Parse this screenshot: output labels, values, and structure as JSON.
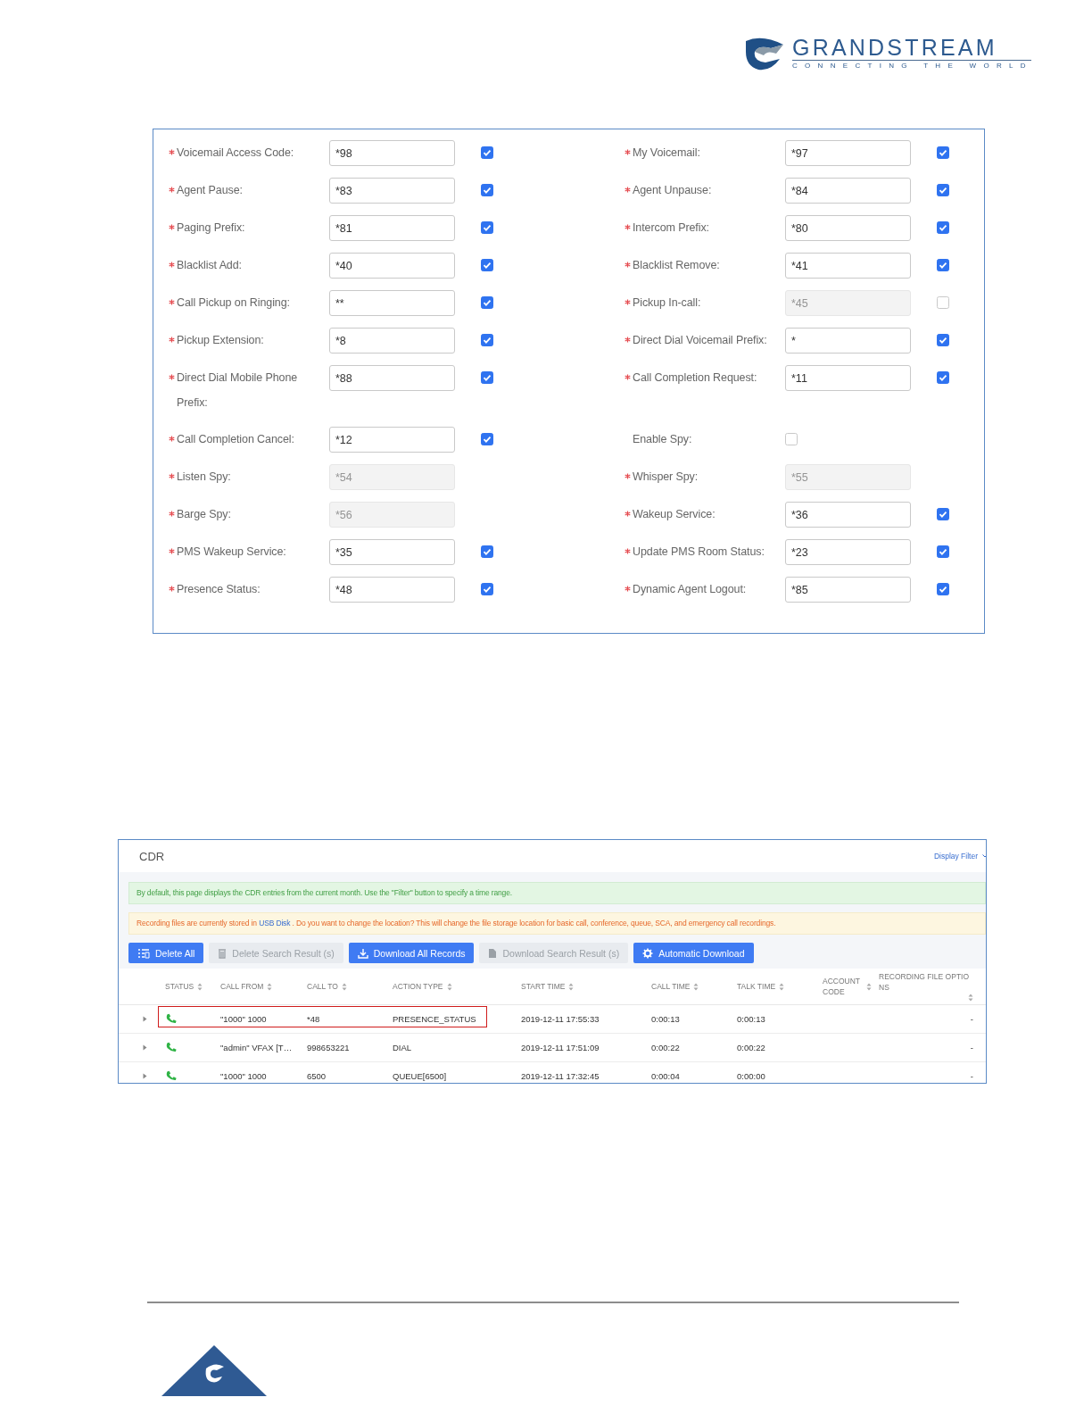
{
  "logo": {
    "name": "GRANDSTREAM",
    "tagline": "CONNECTING THE WORLD"
  },
  "feature_codes": {
    "rows": [
      {
        "left": {
          "kind": "code",
          "label": "Voicemail Access Code:",
          "required": true,
          "value": "*98",
          "disabled": false,
          "checked": true
        },
        "right": {
          "kind": "code",
          "label": "My Voicemail:",
          "required": true,
          "value": "*97",
          "disabled": false,
          "checked": true
        }
      },
      {
        "left": {
          "kind": "code",
          "label": "Agent Pause:",
          "required": true,
          "value": "*83",
          "disabled": false,
          "checked": true
        },
        "right": {
          "kind": "code",
          "label": "Agent Unpause:",
          "required": true,
          "value": "*84",
          "disabled": false,
          "checked": true
        }
      },
      {
        "left": {
          "kind": "code",
          "label": "Paging Prefix:",
          "required": true,
          "value": "*81",
          "disabled": false,
          "checked": true
        },
        "right": {
          "kind": "code",
          "label": "Intercom Prefix:",
          "required": true,
          "value": "*80",
          "disabled": false,
          "checked": true
        }
      },
      {
        "left": {
          "kind": "code",
          "label": "Blacklist Add:",
          "required": true,
          "value": "*40",
          "disabled": false,
          "checked": true
        },
        "right": {
          "kind": "code",
          "label": "Blacklist Remove:",
          "required": true,
          "value": "*41",
          "disabled": false,
          "checked": true
        }
      },
      {
        "left": {
          "kind": "code",
          "label": "Call Pickup on Ringing:",
          "required": true,
          "value": "**",
          "disabled": false,
          "checked": true
        },
        "right": {
          "kind": "code",
          "label": "Pickup In-call:",
          "required": true,
          "value": "*45",
          "disabled": true,
          "checked": false
        }
      },
      {
        "left": {
          "kind": "code",
          "label": "Pickup Extension:",
          "required": true,
          "value": "*8",
          "disabled": false,
          "checked": true
        },
        "right": {
          "kind": "code",
          "label": "Direct Dial Voicemail Prefix:",
          "required": true,
          "value": "*",
          "disabled": false,
          "checked": true
        }
      },
      {
        "left": {
          "kind": "code",
          "label": "Direct Dial Mobile Phone Prefix:",
          "required": true,
          "value": "*88",
          "disabled": false,
          "checked": true
        },
        "right": {
          "kind": "code",
          "label": "Call Completion Request:",
          "required": true,
          "value": "*11",
          "disabled": false,
          "checked": true
        }
      },
      {
        "left": {
          "kind": "code",
          "label": "Call Completion Cancel:",
          "required": true,
          "value": "*12",
          "disabled": false,
          "checked": true
        },
        "right": {
          "kind": "toggle",
          "label": "Enable Spy:",
          "required": false,
          "checked": false
        }
      },
      {
        "left": {
          "kind": "code_only",
          "label": "Listen Spy:",
          "required": true,
          "value": "*54",
          "disabled": true
        },
        "right": {
          "kind": "code_only",
          "label": "Whisper Spy:",
          "required": true,
          "value": "*55",
          "disabled": true
        }
      },
      {
        "left": {
          "kind": "code_only",
          "label": "Barge Spy:",
          "required": true,
          "value": "*56",
          "disabled": true
        },
        "right": {
          "kind": "code",
          "label": "Wakeup Service:",
          "required": true,
          "value": "*36",
          "disabled": false,
          "checked": true
        }
      },
      {
        "left": {
          "kind": "code",
          "label": "PMS Wakeup Service:",
          "required": true,
          "value": "*35",
          "disabled": false,
          "checked": true
        },
        "right": {
          "kind": "code",
          "label": "Update PMS Room Status:",
          "required": true,
          "value": "*23",
          "disabled": false,
          "checked": true
        }
      },
      {
        "left": {
          "kind": "code",
          "label": "Presence Status:",
          "required": true,
          "value": "*48",
          "disabled": false,
          "checked": true
        },
        "right": {
          "kind": "code",
          "label": "Dynamic Agent Logout:",
          "required": true,
          "value": "*85",
          "disabled": false,
          "checked": true
        }
      }
    ]
  },
  "cdr": {
    "title": "CDR",
    "display_filter": "Display Filter",
    "info_notice": "By default, this page displays the CDR entries from the current month. Use the \"Filter\" button to specify a time range.",
    "storage_notice": {
      "before": "Recording files are currently stored in",
      "link": "USB Disk",
      "after": ". Do you want to change the location? This will change the file storage location for basic call, conference, queue, SCA, and emergency call recordings."
    },
    "buttons": [
      {
        "kind": "list",
        "label": "Delete All",
        "disabled": false
      },
      {
        "kind": "trash",
        "label": "Delete Search Result (s)",
        "disabled": true
      },
      {
        "kind": "download",
        "label": "Download All Records",
        "disabled": false
      },
      {
        "kind": "file",
        "label": "Download Search Result (s)",
        "disabled": true
      },
      {
        "kind": "gear",
        "label": "Automatic Download",
        "disabled": false
      }
    ],
    "columns": [
      "STATUS",
      "CALL FROM",
      "CALL TO",
      "ACTION TYPE",
      "START TIME",
      "CALL TIME",
      "TALK TIME",
      "ACCOUNT CODE",
      "RECORDING FILE OPTIONS"
    ],
    "rows": [
      {
        "call_from": "\"1000\" 1000",
        "call_to": "*48",
        "action_type": "PRESENCE_STATUS",
        "start_time": "2019-12-11 17:55:33",
        "call_time": "0:00:13",
        "talk_time": "0:00:13",
        "recording": "-",
        "highlighted": true
      },
      {
        "call_from": "\"admin\" VFAX [T…",
        "call_to": "998653221",
        "action_type": "DIAL",
        "start_time": "2019-12-11 17:51:09",
        "call_time": "0:00:22",
        "talk_time": "0:00:22",
        "recording": "-",
        "highlighted": false
      },
      {
        "call_from": "\"1000\" 1000",
        "call_to": "6500",
        "action_type": "QUEUE[6500]",
        "start_time": "2019-12-11 17:32:45",
        "call_time": "0:00:04",
        "talk_time": "0:00:00",
        "recording": "-",
        "highlighted": false
      }
    ]
  }
}
